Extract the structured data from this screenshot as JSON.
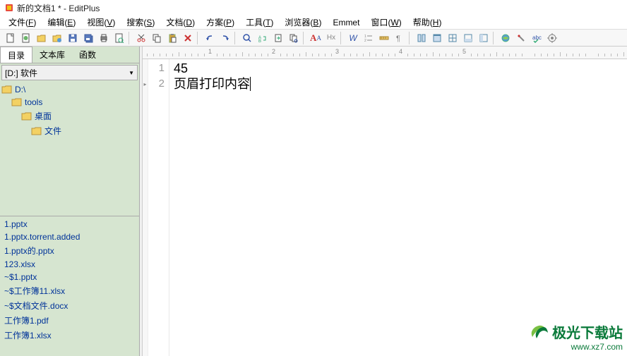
{
  "title": "新的文档1 * - EditPlus",
  "menu": [
    {
      "label": "文件",
      "key": "F"
    },
    {
      "label": "编辑",
      "key": "E"
    },
    {
      "label": "视图",
      "key": "V"
    },
    {
      "label": "搜索",
      "key": "S"
    },
    {
      "label": "文档",
      "key": "D"
    },
    {
      "label": "方案",
      "key": "P"
    },
    {
      "label": "工具",
      "key": "T"
    },
    {
      "label": "浏览器",
      "key": "B"
    },
    {
      "label": "Emmet",
      "key": ""
    },
    {
      "label": "窗口",
      "key": "W"
    },
    {
      "label": "帮助",
      "key": "H"
    }
  ],
  "sidebar": {
    "tabs": [
      "目录",
      "文本库",
      "函数"
    ],
    "active_tab": 0,
    "drive": "[D:] 软件",
    "tree": [
      {
        "label": "D:\\",
        "indent": 0
      },
      {
        "label": "tools",
        "indent": 1
      },
      {
        "label": "桌面",
        "indent": 2
      },
      {
        "label": "文件",
        "indent": 3
      }
    ],
    "files": [
      "1.pptx",
      "1.pptx.torrent.added",
      "1.pptx的.pptx",
      "123.xlsx",
      "~$1.pptx",
      "~$工作簿11.xlsx",
      "~$文档文件.docx",
      "工作簿1.pdf",
      "工作簿1.xlsx"
    ]
  },
  "editor": {
    "ruler_marks": [
      "1",
      "2",
      "3",
      "4",
      "5"
    ],
    "lines": [
      {
        "num": "1",
        "text": "45"
      },
      {
        "num": "2",
        "text": "页眉打印内容"
      }
    ]
  },
  "watermark": {
    "text": "极光下载站",
    "url": "www.xz7.com"
  }
}
